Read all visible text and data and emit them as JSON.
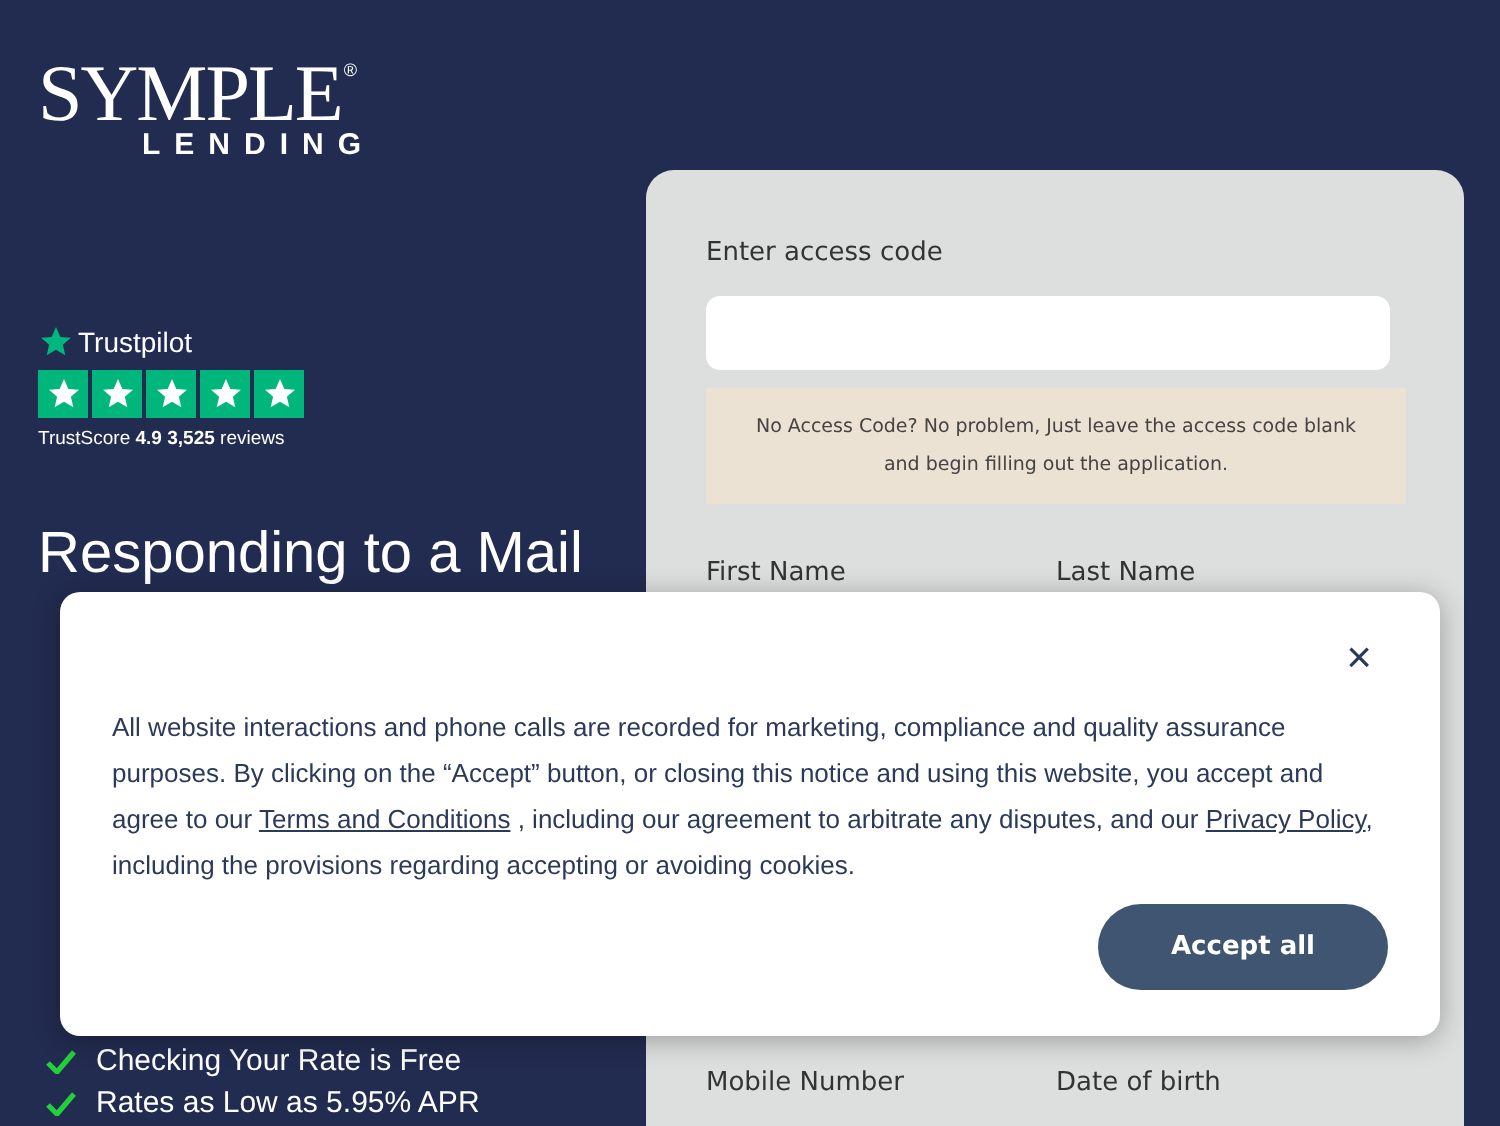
{
  "logo": {
    "wordmark": "SYMPLE",
    "registered": "®",
    "subline": "LENDING"
  },
  "trustpilot": {
    "brand": "Trustpilot",
    "stars": 5,
    "score": "TrustScore **4.9** **3,525** reviews"
  },
  "heading": "Responding to a Mail",
  "benefits": [
    {
      "text": "Checking Your Rate is Free"
    },
    {
      "text": "Rates as Low as 5.95% APR"
    }
  ],
  "form": {
    "access_label": "Enter access code",
    "note": "No Access Code? No problem, Just leave the access code blank and begin filling out  the application.",
    "row_labels": [
      "First Name",
      "Last Name"
    ],
    "bottom_labels": [
      "Mobile Number",
      "Date of birth"
    ]
  },
  "cookie_notice": {
    "lines": [
      {
        "kind": "text",
        "text": "All website interactions and phone calls are recorded for marketing, compliance and quality assurance purposes. By clicking on the “Accept” button, or closing this notice and using this website, you accept and agree to our "
      },
      {
        "kind": "link",
        "text": "Terms and Conditions"
      },
      {
        "kind": "text",
        "text": " , including our agreement to arbitrate any disputes, and our "
      },
      {
        "kind": "link",
        "text": "Privacy Policy"
      },
      {
        "kind": "text",
        "text": ", including the provisions regarding accepting or avoiding cookies."
      }
    ],
    "close": "×",
    "button": "Accept all"
  }
}
